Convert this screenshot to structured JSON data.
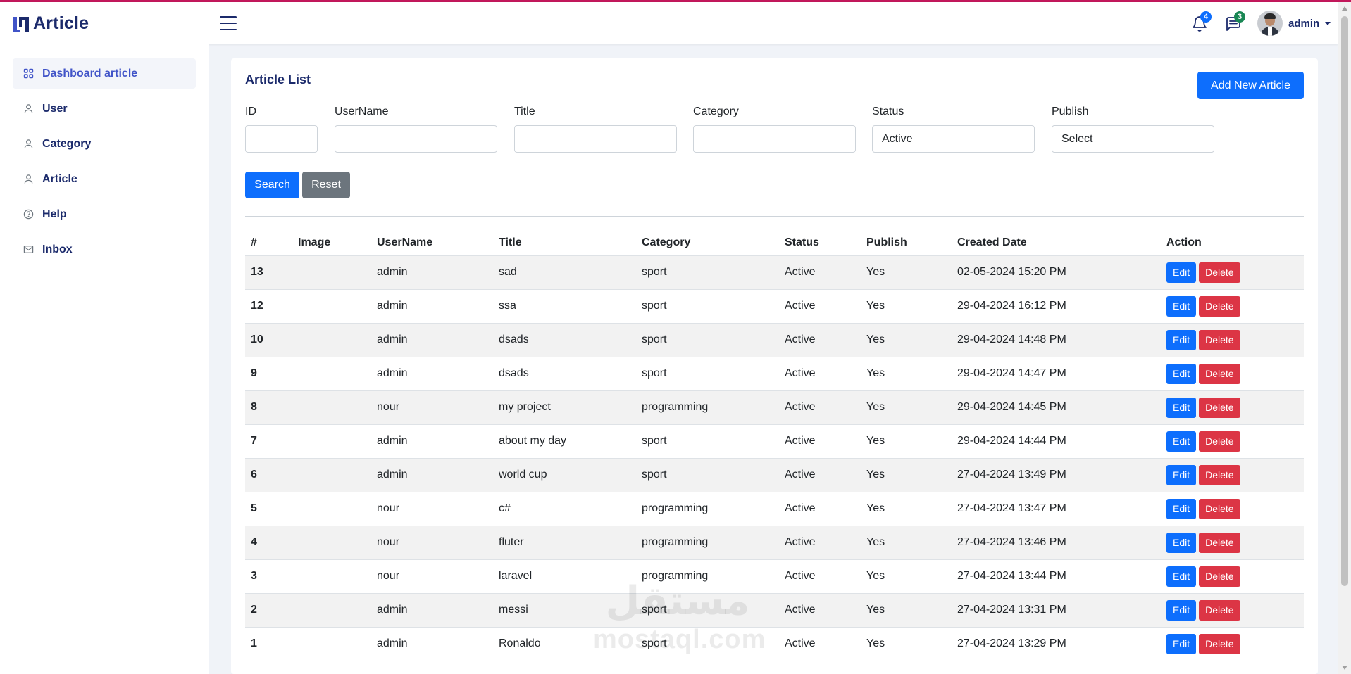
{
  "brand": {
    "logo_text": "Article",
    "accent_color": "#c2185b",
    "primary_color": "#0d6efd",
    "danger_color": "#dc3545"
  },
  "header": {
    "notifications_count": "4",
    "messages_count": "3",
    "user_name": "admin"
  },
  "sidebar": {
    "items": [
      {
        "label": "Dashboard article",
        "icon": "grid-icon",
        "active": true
      },
      {
        "label": "User",
        "icon": "user-icon"
      },
      {
        "label": "Category",
        "icon": "user-icon"
      },
      {
        "label": "Article",
        "icon": "user-icon"
      },
      {
        "label": "Help",
        "icon": "question-circle-icon"
      },
      {
        "label": "Inbox",
        "icon": "envelope-icon"
      }
    ]
  },
  "main": {
    "title": "Article List",
    "add_button": "Add New Article",
    "filters": {
      "id": {
        "label": "ID",
        "value": ""
      },
      "username": {
        "label": "UserName",
        "value": ""
      },
      "title": {
        "label": "Title",
        "value": ""
      },
      "category": {
        "label": "Category",
        "value": ""
      },
      "status": {
        "label": "Status",
        "value": "Active"
      },
      "publish": {
        "label": "Publish",
        "value": "Select"
      }
    },
    "search_button": "Search",
    "reset_button": "Reset",
    "table": {
      "columns": [
        "#",
        "Image",
        "UserName",
        "Title",
        "Category",
        "Status",
        "Publish",
        "Created Date",
        "Action"
      ],
      "edit_label": "Edit",
      "delete_label": "Delete",
      "rows": [
        {
          "id": "13",
          "image": "",
          "username": "admin",
          "title": "sad",
          "category": "sport",
          "status": "Active",
          "publish": "Yes",
          "created": "02-05-2024 15:20 PM"
        },
        {
          "id": "12",
          "image": "",
          "username": "admin",
          "title": "ssa",
          "category": "sport",
          "status": "Active",
          "publish": "Yes",
          "created": "29-04-2024 16:12 PM"
        },
        {
          "id": "10",
          "image": "",
          "username": "admin",
          "title": "dsads",
          "category": "sport",
          "status": "Active",
          "publish": "Yes",
          "created": "29-04-2024 14:48 PM"
        },
        {
          "id": "9",
          "image": "",
          "username": "admin",
          "title": "dsads",
          "category": "sport",
          "status": "Active",
          "publish": "Yes",
          "created": "29-04-2024 14:47 PM"
        },
        {
          "id": "8",
          "image": "",
          "username": "nour",
          "title": "my project",
          "category": "programming",
          "status": "Active",
          "publish": "Yes",
          "created": "29-04-2024 14:45 PM"
        },
        {
          "id": "7",
          "image": "",
          "username": "admin",
          "title": "about my day",
          "category": "sport",
          "status": "Active",
          "publish": "Yes",
          "created": "29-04-2024 14:44 PM"
        },
        {
          "id": "6",
          "image": "",
          "username": "admin",
          "title": "world cup",
          "category": "sport",
          "status": "Active",
          "publish": "Yes",
          "created": "27-04-2024 13:49 PM"
        },
        {
          "id": "5",
          "image": "",
          "username": "nour",
          "title": "c#",
          "category": "programming",
          "status": "Active",
          "publish": "Yes",
          "created": "27-04-2024 13:47 PM"
        },
        {
          "id": "4",
          "image": "",
          "username": "nour",
          "title": "fluter",
          "category": "programming",
          "status": "Active",
          "publish": "Yes",
          "created": "27-04-2024 13:46 PM"
        },
        {
          "id": "3",
          "image": "",
          "username": "nour",
          "title": "laravel",
          "category": "programming",
          "status": "Active",
          "publish": "Yes",
          "created": "27-04-2024 13:44 PM"
        },
        {
          "id": "2",
          "image": "",
          "username": "admin",
          "title": "messi",
          "category": "sport",
          "status": "Active",
          "publish": "Yes",
          "created": "27-04-2024 13:31 PM"
        },
        {
          "id": "1",
          "image": "",
          "username": "admin",
          "title": "Ronaldo",
          "category": "sport",
          "status": "Active",
          "publish": "Yes",
          "created": "27-04-2024 13:29 PM"
        }
      ]
    }
  },
  "watermark": {
    "arabic": "مستقل",
    "latin": "mostaql.com"
  }
}
